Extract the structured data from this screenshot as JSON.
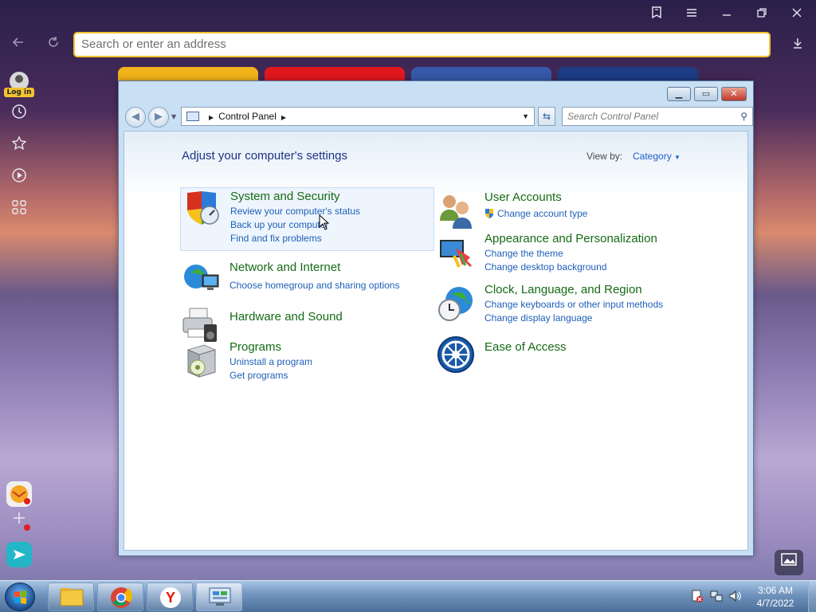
{
  "browser": {
    "address_placeholder": "Search or enter an address",
    "login_label": "Log in",
    "icons": [
      "bookmarks-icon",
      "menu-icon",
      "minimize-icon",
      "restore-icon",
      "close-icon",
      "back-icon",
      "refresh-icon",
      "download-icon",
      "history-icon",
      "star-icon",
      "play-icon",
      "apps-icon",
      "photo-icon"
    ]
  },
  "control_panel": {
    "breadcrumb": "Control Panel",
    "search_placeholder": "Search Control Panel",
    "heading": "Adjust your computer's settings",
    "view_by_label": "View by:",
    "view_by_value": "Category",
    "left_column": [
      {
        "title": "System and Security",
        "links": [
          "Review your computer's status",
          "Back up your computer",
          "Find and fix problems"
        ],
        "icon": "shield-icon"
      },
      {
        "title": "Network and Internet",
        "links": [
          "Choose homegroup and sharing options"
        ],
        "icon": "network-icon"
      },
      {
        "title": "Hardware and Sound",
        "links": [],
        "icon": "printer-icon"
      },
      {
        "title": "Programs",
        "links": [
          "Uninstall a program",
          "Get programs"
        ],
        "icon": "programs-icon"
      }
    ],
    "right_column": [
      {
        "title": "User Accounts",
        "links": [
          "Change account type"
        ],
        "icon": "users-icon"
      },
      {
        "title": "Appearance and Personalization",
        "links": [
          "Change the theme",
          "Change desktop background"
        ],
        "icon": "appearance-icon"
      },
      {
        "title": "Clock, Language, and Region",
        "links": [
          "Change keyboards or other input methods",
          "Change display language"
        ],
        "icon": "clock-globe-icon"
      },
      {
        "title": "Ease of Access",
        "links": [],
        "icon": "ease-of-access-icon"
      }
    ]
  },
  "taskbar": {
    "time": "3:06 AM",
    "date": "4/7/2022",
    "items": [
      "file-explorer-icon",
      "chrome-icon",
      "yandex-icon",
      "control-panel-icon"
    ]
  },
  "colors": {
    "accent_yellow": "#f2c230",
    "category_title": "#156a15",
    "link_blue": "#1e5fb8",
    "heading_blue": "#1e3287"
  }
}
